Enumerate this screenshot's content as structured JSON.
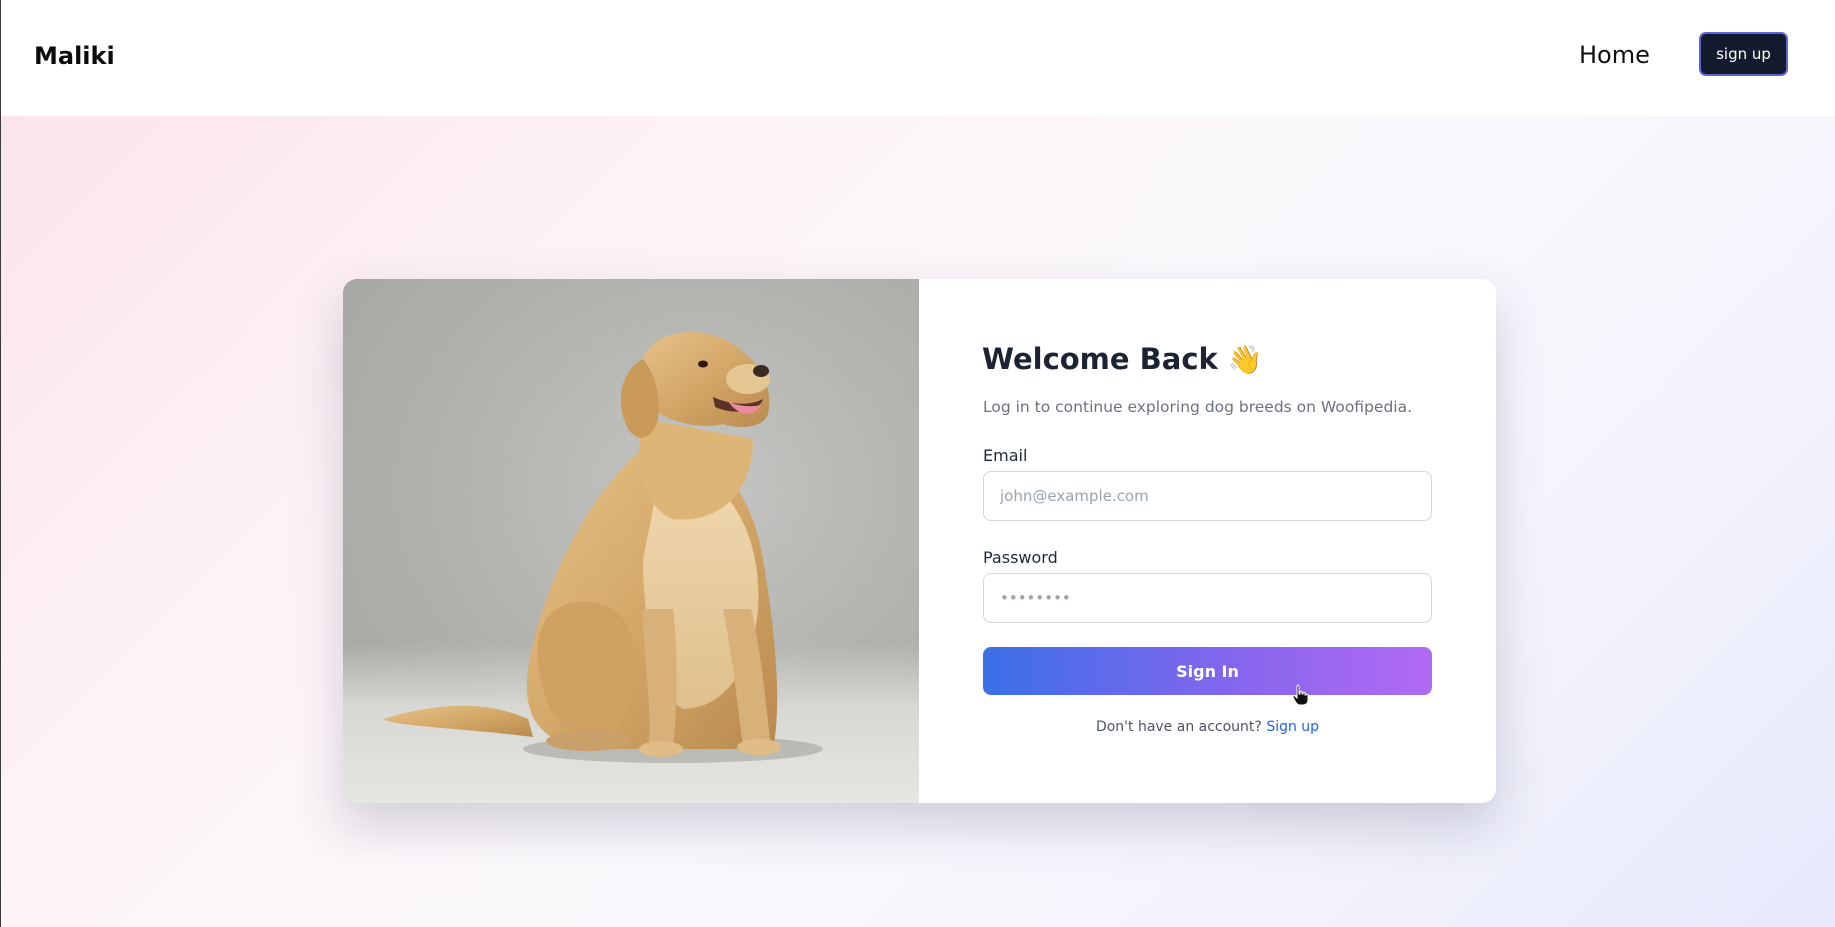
{
  "nav": {
    "brand": "Maliki",
    "home_label": "Home",
    "signup_label": "sign up"
  },
  "login": {
    "title": "Welcome Back",
    "wave_emoji": "👋",
    "subtitle": "Log in to continue exploring dog breeds on Woofipedia.",
    "email_label": "Email",
    "email_placeholder": "john@example.com",
    "password_label": "Password",
    "password_placeholder": "••••••••",
    "submit_label": "Sign In",
    "footer_text": "Don't have an account?",
    "footer_link": "Sign up"
  },
  "colors": {
    "signup_button_bg": "#141a2e",
    "submit_gradient_start": "#3b6fe8",
    "submit_gradient_end": "#b26af3",
    "link": "#2563eb"
  },
  "icons": {
    "cursor": "hand-pointer-icon"
  }
}
